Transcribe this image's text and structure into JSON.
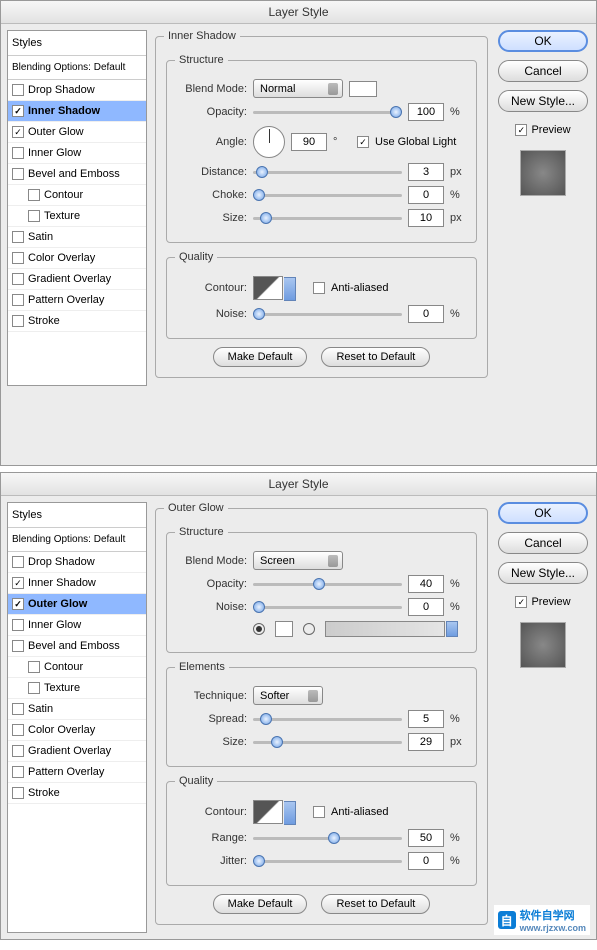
{
  "dialog1": {
    "title": "Layer Style",
    "styles_header": "Styles",
    "blending": "Blending Options: Default",
    "items": [
      {
        "label": "Drop Shadow",
        "checked": false
      },
      {
        "label": "Inner Shadow",
        "checked": true,
        "selected": true
      },
      {
        "label": "Outer Glow",
        "checked": true
      },
      {
        "label": "Inner Glow",
        "checked": false
      },
      {
        "label": "Bevel and Emboss",
        "checked": false
      },
      {
        "label": "Contour",
        "checked": false,
        "indent": true
      },
      {
        "label": "Texture",
        "checked": false,
        "indent": true
      },
      {
        "label": "Satin",
        "checked": false
      },
      {
        "label": "Color Overlay",
        "checked": false
      },
      {
        "label": "Gradient Overlay",
        "checked": false
      },
      {
        "label": "Pattern Overlay",
        "checked": false
      },
      {
        "label": "Stroke",
        "checked": false
      }
    ],
    "effect_title": "Inner Shadow",
    "structure": "Structure",
    "blend_mode_label": "Blend Mode:",
    "blend_mode": "Normal",
    "opacity_label": "Opacity:",
    "opacity": "100",
    "pct": "%",
    "angle_label": "Angle:",
    "angle": "90",
    "deg": "°",
    "global_light": "Use Global Light",
    "distance_label": "Distance:",
    "distance": "3",
    "px": "px",
    "choke_label": "Choke:",
    "choke": "0",
    "size_label": "Size:",
    "size": "10",
    "quality": "Quality",
    "contour_label": "Contour:",
    "anti_aliased": "Anti-aliased",
    "noise_label": "Noise:",
    "noise": "0",
    "make_default": "Make Default",
    "reset_default": "Reset to Default",
    "ok": "OK",
    "cancel": "Cancel",
    "new_style": "New Style...",
    "preview": "Preview"
  },
  "dialog2": {
    "title": "Layer Style",
    "styles_header": "Styles",
    "blending": "Blending Options: Default",
    "items": [
      {
        "label": "Drop Shadow",
        "checked": false
      },
      {
        "label": "Inner Shadow",
        "checked": true
      },
      {
        "label": "Outer Glow",
        "checked": true,
        "selected": true
      },
      {
        "label": "Inner Glow",
        "checked": false
      },
      {
        "label": "Bevel and Emboss",
        "checked": false
      },
      {
        "label": "Contour",
        "checked": false,
        "indent": true
      },
      {
        "label": "Texture",
        "checked": false,
        "indent": true
      },
      {
        "label": "Satin",
        "checked": false
      },
      {
        "label": "Color Overlay",
        "checked": false
      },
      {
        "label": "Gradient Overlay",
        "checked": false
      },
      {
        "label": "Pattern Overlay",
        "checked": false
      },
      {
        "label": "Stroke",
        "checked": false
      }
    ],
    "effect_title": "Outer Glow",
    "structure": "Structure",
    "blend_mode_label": "Blend Mode:",
    "blend_mode": "Screen",
    "opacity_label": "Opacity:",
    "opacity": "40",
    "noise_label": "Noise:",
    "noise": "0",
    "pct": "%",
    "elements": "Elements",
    "technique_label": "Technique:",
    "technique": "Softer",
    "spread_label": "Spread:",
    "spread": "5",
    "size_label": "Size:",
    "size": "29",
    "px": "px",
    "quality": "Quality",
    "contour_label": "Contour:",
    "anti_aliased": "Anti-aliased",
    "range_label": "Range:",
    "range": "50",
    "jitter_label": "Jitter:",
    "jitter": "0",
    "make_default": "Make Default",
    "reset_default": "Reset to Default",
    "ok": "OK",
    "cancel": "Cancel",
    "new_style": "New Style...",
    "preview": "Preview"
  },
  "watermark": {
    "text": "软件自学网",
    "url": "www.rjzxw.com"
  }
}
